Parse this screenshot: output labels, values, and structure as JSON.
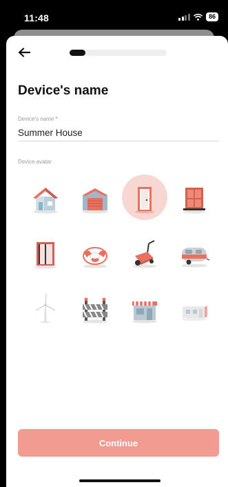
{
  "status_bar": {
    "time": "11:48",
    "battery": "86"
  },
  "nav": {
    "back_icon": "arrow-left-icon",
    "progress": 0.16
  },
  "page": {
    "title": "Device's name"
  },
  "name_field": {
    "label": "Device's name",
    "required_marker": "*",
    "value": "Summer House"
  },
  "avatar_section": {
    "label": "Device avatar",
    "selected": "door",
    "items": [
      "house",
      "garage",
      "door",
      "window",
      "sliding-door",
      "lifebuoy",
      "lawn-mower",
      "caravan",
      "wind-turbine",
      "barrier",
      "shop",
      "container"
    ]
  },
  "continue_button": {
    "label": "Continue"
  },
  "colors": {
    "accent": "#f19b91",
    "selected_bg": "#f8d7d3",
    "avatar_primary": "#e8705f"
  }
}
